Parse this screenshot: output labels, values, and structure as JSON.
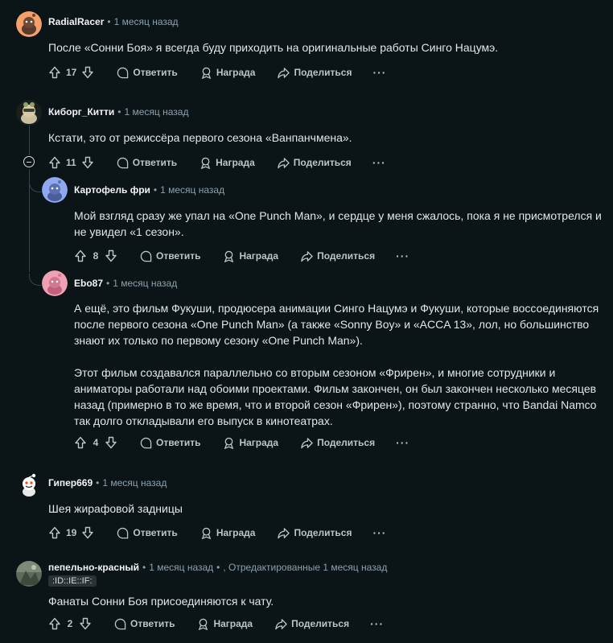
{
  "labels": {
    "reply": "Ответить",
    "award": "Награда",
    "share": "Поделиться",
    "more": "···"
  },
  "comments": [
    {
      "author": "RadialRacer",
      "time": "1 месяц назад",
      "paragraphs": [
        "После «Сонни Боя» я всегда буду приходить на оригинальные работы Синго Нацумэ."
      ],
      "votes": "17",
      "avatar_color": "#f5a06b"
    },
    {
      "author": "Киборг_Китти",
      "time": "1 месяц назад",
      "paragraphs": [
        "Кстати, это от режиссёра первого сезона «Ванпанчмена»."
      ],
      "votes": "11",
      "avatar_color": "#d8c9a4"
    },
    {
      "author": "Картофель фри",
      "time": "1 месяц назад",
      "paragraphs": [
        "Мой взгляд сразу же упал на «One Punch Man», и сердце у меня сжалось, пока я не присмотрелся и не увидел «1 сезон»."
      ],
      "votes": "8",
      "avatar_color": "#8fa8f0"
    },
    {
      "author": "Ebo87",
      "time": "1 месяц назад",
      "paragraphs": [
        "А ещё, это фильм Фукуши, продюсера анимации Синго Нацумэ и Фукуши, которые воссоединяются после первого сезона «One Punch Man» (а также «Sonny Boy» и «ACCA 13», лол, но большинство знают их только по первому сезону «One Punch Man»).",
        "Этот фильм создавался параллельно со вторым сезоном «Фрирен», и многие сотрудники и аниматоры работали над обоими проектами. Фильм закончен, он был закончен несколько месяцев назад (примерно в то же время, что и второй сезон «Фрирен»), поэтому странно, что Bandai Namco так долго откладывали его выпуск в кинотеатрах."
      ],
      "votes": "4",
      "avatar_color": "#f0a0b4"
    },
    {
      "author": "Гипер669",
      "time": "1 месяц назад",
      "paragraphs": [
        "Шея жирафовой задницы"
      ],
      "votes": "19",
      "avatar_color": "#ffffff"
    },
    {
      "author": "пепельно-красный",
      "time": "1 месяц назад",
      "edited": ", Отредактированные 1 месяц назад",
      "flair": ":ID::IE::IF:",
      "paragraphs": [
        "Фанаты Сонни Боя присоединяются к чату."
      ],
      "votes": "2",
      "avatar_color": "#6f7e6a"
    }
  ],
  "colors": {
    "background": "#0b1416",
    "text": "#e2e7e9",
    "meta": "#8ba2ad",
    "thread_line": "#33464c"
  }
}
